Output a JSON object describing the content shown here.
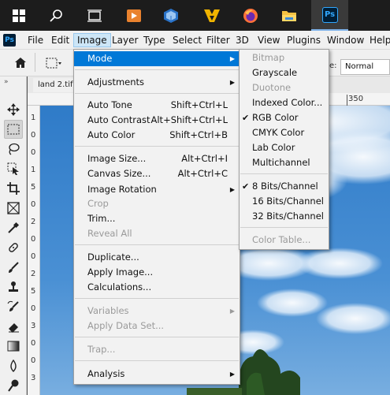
{
  "menubar": {
    "app_icon": "Ps",
    "items": [
      "File",
      "Edit",
      "Image",
      "Layer",
      "Type",
      "Select",
      "Filter",
      "3D",
      "View",
      "Plugins",
      "Window",
      "Help"
    ]
  },
  "taskbar": {
    "icons": [
      "windows-start-icon",
      "search-icon",
      "task-view-icon",
      "media-player-icon",
      "virtualbox-icon",
      "app-icon",
      "firefox-icon",
      "file-explorer-icon",
      "photoshop-icon"
    ],
    "ps_label": "Ps"
  },
  "options": {
    "blend_mode": "Normal"
  },
  "document": {
    "tab_title": "land 2.tif @",
    "ruler_mark": "350",
    "left_ruler_digits": [
      "1",
      "0",
      "0",
      "1",
      "5",
      "0",
      "2",
      "0",
      "0",
      "2",
      "5",
      "0",
      "3",
      "0",
      "0",
      "3"
    ]
  },
  "image_menu": {
    "mode": "Mode",
    "adjustments": "Adjustments",
    "auto_tone": "Auto Tone",
    "auto_tone_sc": "Shift+Ctrl+L",
    "auto_contrast": "Auto Contrast",
    "auto_contrast_sc": "Alt+Shift+Ctrl+L",
    "auto_color": "Auto Color",
    "auto_color_sc": "Shift+Ctrl+B",
    "image_size": "Image Size...",
    "image_size_sc": "Alt+Ctrl+I",
    "canvas_size": "Canvas Size...",
    "canvas_size_sc": "Alt+Ctrl+C",
    "image_rotation": "Image Rotation",
    "crop": "Crop",
    "trim": "Trim...",
    "reveal_all": "Reveal All",
    "duplicate": "Duplicate...",
    "apply_image": "Apply Image...",
    "calculations": "Calculations...",
    "variables": "Variables",
    "apply_data_set": "Apply Data Set...",
    "trap": "Trap...",
    "analysis": "Analysis"
  },
  "mode_menu": {
    "bitmap": "Bitmap",
    "grayscale": "Grayscale",
    "duotone": "Duotone",
    "indexed_color": "Indexed Color...",
    "rgb_color": "RGB Color",
    "cmyk_color": "CMYK Color",
    "lab_color": "Lab Color",
    "multichannel": "Multichannel",
    "bits8": "8 Bits/Channel",
    "bits16": "16 Bits/Channel",
    "bits32": "32 Bits/Channel",
    "color_table": "Color Table...",
    "checked": [
      "RGB Color",
      "8 Bits/Channel"
    ]
  },
  "colors": {
    "highlight": "#0078d7",
    "sky": "#3e86cc",
    "ps_blue": "#31a8ff",
    "ps_dark": "#001e36"
  }
}
